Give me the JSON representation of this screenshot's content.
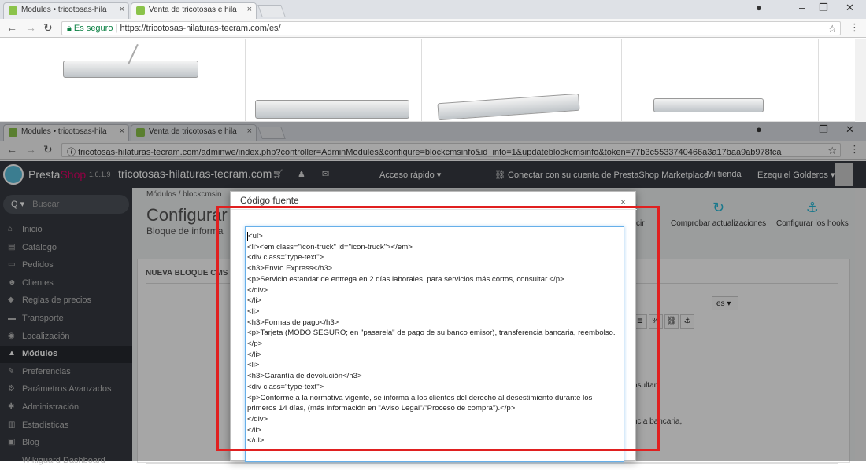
{
  "browser_top": {
    "tabs": [
      "Modules • tricotosas-hila",
      "Venta de tricotosas e hila"
    ],
    "secure_label": "Es seguro",
    "url": "https://tricotosas-hilaturas-tecram.com/es/"
  },
  "browser_mid": {
    "tabs": [
      "Modules • tricotosas-hila",
      "Venta de tricotosas e hila"
    ],
    "url": "tricotosas-hilaturas-tecram.com/adminwe/index.php?controller=AdminModules&configure=blockcmsinfo&id_info=1&updateblockcmsinfo&token=77b3c5533740466a3a17baa9ab978fca"
  },
  "ps_header": {
    "brand_a": "Presta",
    "brand_b": "Shop",
    "version": "1.6.1.9",
    "site": "tricotosas-hilaturas-tecram.com",
    "quick_access": "Acceso rápido ▾",
    "connect": "Conectar con su cuenta de PrestaShop Marketplace",
    "my_store": "Mi tienda",
    "user": "Ezequiel Golderos ▾"
  },
  "sidebar": {
    "search": "Buscar",
    "items": [
      {
        "label": "Inicio",
        "icon": "⌂"
      },
      {
        "label": "Catálogo",
        "icon": "▤"
      },
      {
        "label": "Pedidos",
        "icon": "▭"
      },
      {
        "label": "Clientes",
        "icon": "☻"
      },
      {
        "label": "Reglas de precios",
        "icon": "◆"
      },
      {
        "label": "Transporte",
        "icon": "▬"
      },
      {
        "label": "Localización",
        "icon": "◉"
      },
      {
        "label": "Módulos",
        "icon": "▲"
      },
      {
        "label": "Preferencias",
        "icon": "✎"
      },
      {
        "label": "Parámetros Avanzados",
        "icon": "⚙"
      },
      {
        "label": "Administración",
        "icon": "✱"
      },
      {
        "label": "Estadísticas",
        "icon": "▥"
      },
      {
        "label": "Blog",
        "icon": "▣"
      },
      {
        "label": "Wikiguard Dashboard",
        "icon": ""
      }
    ],
    "active_index": 7
  },
  "content": {
    "breadcrumb": "Módulos  /  blockcmsin",
    "title": "Configurar",
    "subtitle": "Bloque de informa",
    "tool_translate": "raducir",
    "tool_check": "Comprobar actualizaciones",
    "tool_hooks": "Configurar los hooks",
    "panel_head": "NUEVA BLOQUE CMS PERS",
    "lang": "es ▾",
    "bg_text_1": "nsultar.",
    "bg_text_2": "ncia bancaria,"
  },
  "modal": {
    "title": "Código fuente",
    "close": "×",
    "code_lines": [
      "<ul>",
      "<li><em class=\"icon-truck\" id=\"icon-truck\"></em>",
      "<div class=\"type-text\">",
      "<h3>Envío Express</h3>",
      "<p>Servicio estandar de entrega en 2 días laborales, para servicios más cortos, consultar.</p>",
      "</div>",
      "</li>",
      "<li>",
      "<h3>Formas de pago</h3>",
      "<p>Tarjeta (MODO SEGURO; en \"pasarela\" de pago de su banco emisor), transferencia bancaria, reembolso.</p>",
      "</li>",
      "<li>",
      "<h3>Garantía de devolución</h3>",
      "<div class=\"type-text\">",
      "<p>Conforme a la normativa vigente, se informa a los clientes del derecho al desestimiento durante los primeros 14 días, (más información en \"Aviso Legal\"/\"Proceso de compra\").</p>",
      "</div>",
      "</li>",
      "</ul>"
    ]
  },
  "colors": {
    "highlight": "#e02020",
    "ps_dark": "#363a41",
    "ps_accent": "#25b9d7"
  }
}
